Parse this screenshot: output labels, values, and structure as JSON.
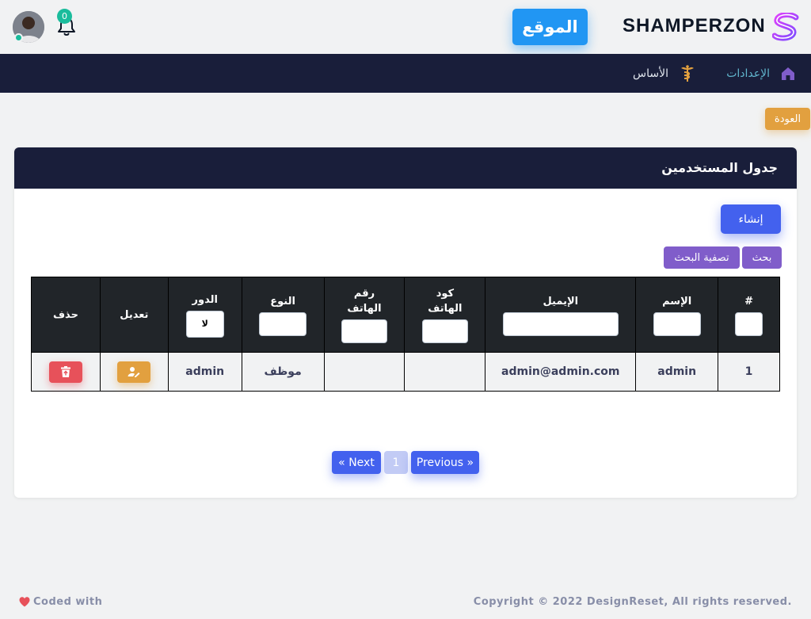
{
  "header": {
    "brand_name": "SHAMPERZON",
    "site_button": "الموقع",
    "notifications_count": "0"
  },
  "nav": {
    "settings": "الإعدادات",
    "base": "الأساس"
  },
  "back_button": "العودة",
  "card": {
    "title": "جدول المستخدمين",
    "create_button": "إنشاء",
    "search_button": "بحث",
    "filter_button": "تصفية البحث"
  },
  "table": {
    "headers": {
      "index": "#",
      "name": "الإسم",
      "email": "الإيميل",
      "phone_code_1": "كود",
      "phone_code_2": "الهاتف",
      "phone_1": "رقم",
      "phone_2": "الهاتف",
      "type": "النوع",
      "role": "الدور",
      "edit": "تعديل",
      "delete": "حذف"
    },
    "role_select_value": "لا",
    "rows": [
      {
        "index": "1",
        "name": "admin",
        "email": "admin@admin.com",
        "phone_code": "",
        "phone": "",
        "type": "موظف",
        "role": "admin"
      }
    ]
  },
  "pagination": {
    "next": "« Next",
    "current": "1",
    "previous": "Previous »"
  },
  "footer": {
    "copyright": "Copyright © 2022 DesignReset, All rights reserved.",
    "coded_with": "Coded with"
  },
  "colors": {
    "navbar": "#191e3a",
    "primary": "#4361ee",
    "secondary": "#805dca",
    "warning": "#e2a03f",
    "danger": "#e7515a",
    "info": "#2196f3",
    "success": "#1abc9c"
  },
  "icons": {
    "brand": "s-logo-icon",
    "bell": "bell-icon",
    "home": "home-icon",
    "base": "caduceus-icon",
    "edit": "user-edit-icon",
    "delete": "trash-icon",
    "heart": "heart-icon"
  }
}
